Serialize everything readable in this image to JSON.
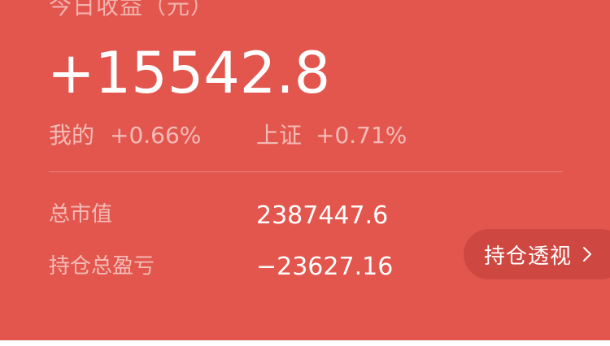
{
  "summary": {
    "today_label": "今日收益（元）",
    "today_value": "+15542.8",
    "mine_label": "我的",
    "mine_value": "+0.66%",
    "index_label": "上证",
    "index_value": "+0.71%"
  },
  "details": {
    "total_value_label": "总市值",
    "total_value": "2387447.6",
    "holding_pnl_label": "持仓总盈亏",
    "holding_pnl": "−23627.16"
  },
  "actions": {
    "holdings_button_label": "持仓透视",
    "holdings_button_icon": "chevron-right-icon"
  },
  "colors": {
    "card_background": "#e2564d",
    "button_background": "#cf4741"
  }
}
